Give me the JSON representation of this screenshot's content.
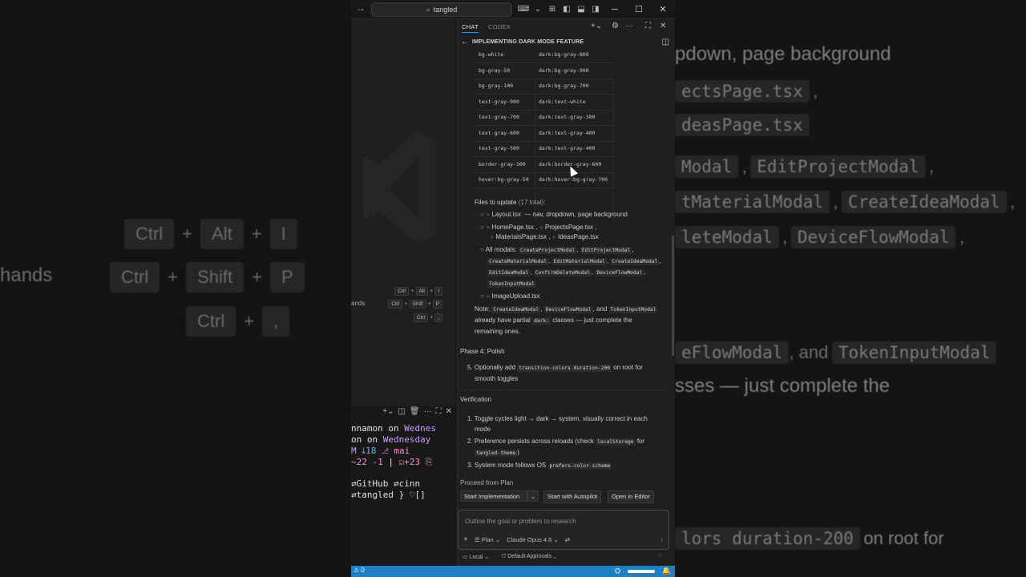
{
  "titlebar": {
    "search_text": "tangled"
  },
  "editor": {
    "shortcuts": [
      {
        "keys": [
          "Ctrl",
          "Alt",
          "I"
        ]
      },
      {
        "label": "ands",
        "keys": [
          "Ctrl",
          "Shift",
          "P"
        ]
      },
      {
        "keys": [
          "Ctrl",
          ","
        ]
      }
    ]
  },
  "terminal": {
    "lines": [
      {
        "parts": [
          {
            "t": "nnamon on ",
            "c": "#e0e0e0"
          },
          {
            "t": "Wednes",
            "c": "#c89cff"
          }
        ]
      },
      {
        "parts": [
          {
            "t": "on on ",
            "c": "#e0e0e0"
          },
          {
            "t": "Wednesday",
            "c": "#c89cff"
          }
        ]
      },
      {
        "parts": [
          {
            "t": "M  ",
            "c": "#c89cff"
          },
          {
            "t": "⤓18  ",
            "c": "#6ab0ff"
          },
          {
            "t": "⎇ mai",
            "c": "#ff8fd0"
          }
        ]
      },
      {
        "parts": [
          {
            "t": "~22 -1 ",
            "c": "#ff8fd0"
          },
          {
            "t": "| ",
            "c": "#e0e0e0"
          },
          {
            "t": "☑+23 ",
            "c": "#ff8fd0"
          },
          {
            "t": "⎘",
            "c": "#ff8fd0"
          }
        ]
      },
      {
        "parts": [
          {
            "t": "⇄GitHub ⇄cinn",
            "c": "#e0e0e0"
          }
        ]
      },
      {
        "parts": [
          {
            "t": "⇄tangled } ♡[]",
            "c": "#e0e0e0"
          }
        ]
      }
    ]
  },
  "chat": {
    "tabs": {
      "chat": "CHAT",
      "codex": "CODEX"
    },
    "title": "IMPLEMENTING DARK MODE FEATURE",
    "table": [
      [
        "bg-white",
        "dark:bg-gray-800"
      ],
      [
        "bg-gray-50",
        "dark:bg-gray-900"
      ],
      [
        "bg-gray-100",
        "dark:bg-gray-700"
      ],
      [
        "text-gray-900",
        "dark:text-white"
      ],
      [
        "text-gray-700",
        "dark:text-gray-300"
      ],
      [
        "text-gray-600",
        "dark:text-gray-400"
      ],
      [
        "text-gray-500",
        "dark:text-gray-400"
      ],
      [
        "border-gray-300",
        "dark:border-gray-600"
      ],
      [
        "hover:bg-gray-50",
        "dark:hover:bg-gray-700"
      ]
    ],
    "files_label": "Files to update",
    "files_count": "(17 total):",
    "layout_file": "Layout.tsx",
    "layout_desc": "— nav, dropdown, page background",
    "pages": [
      "HomePage.tsx",
      "ProjectsPage.tsx",
      "MaterialsPage.tsx",
      "IdeasPage.tsx"
    ],
    "modals_label": "All modals:",
    "modals": [
      "CreateProjectModal",
      "EditProjectModal",
      "CreateMaterialModal",
      "EditMaterialModal",
      "CreateIdeaModal",
      "EditIdeaModal",
      "ConfirmDeleteModal",
      "DeviceFlowModal",
      "TokenInputModal"
    ],
    "image_upload": "ImageUpload.tsx",
    "note_label": "Note:",
    "note_codes": [
      "CreateIdeaModal",
      "DeviceFlowModal",
      "TokenInputModal"
    ],
    "note_and": "and",
    "note_line2_pre": "already have partial",
    "note_code_dark": "dark:",
    "note_line2_post": "classes — just complete the",
    "note_line3": "remaining ones.",
    "phase4": "Phase 4: Polish",
    "step5_num": "5.",
    "step5_pre": "Optionally add",
    "step5_code": "transition-colors duration-200",
    "step5_post": "on root for",
    "step5_line2": "smooth toggles",
    "verification": "Verification",
    "v1_num": "1.",
    "v1_line1": "Toggle cycles light → dark → system, visually correct in each",
    "v1_line2": "mode",
    "v2_num": "2.",
    "v2_pre": "Preference persists across reloads (check",
    "v2_code": "localStorage",
    "v2_post": "for",
    "v2_code2": "tangled-theme",
    "v2_close": ")",
    "v3_num": "3.",
    "v3_pre": "System mode follows OS",
    "v3_code": "prefers-color-scheme",
    "proceed": "Proceed from Plan",
    "btn_start": "Start Implementation",
    "btn_autopilot": "Start with Autopilot",
    "btn_editor": "Open in Editor",
    "input_placeholder": "Outline the goal or problem to research",
    "mode": "Plan",
    "model": "Claude Opus 4.6",
    "local": "Local",
    "approvals": "Default Approvals"
  },
  "status": {
    "problems": "0"
  },
  "background_right": {
    "line1": "pdown, page background",
    "line2": "ectsPage.tsx",
    "line2_suffix": ",",
    "line3": "deasPage.tsx",
    "line4a": "Modal",
    "line4b": "EditProjectModal",
    "line4c": ",",
    "line5a": "tMaterialModal",
    "line5b": "CreateIdeaModal",
    "line5c": ",",
    "line6a": "leteModal",
    "line6b": "DeviceFlowModal",
    "line6c": ",",
    "line7a": "eFlowModal",
    "line7b": ", and",
    "line7c": "TokenInputModal",
    "line8": "sses — just complete the",
    "line9a": "lors duration-200",
    "line9b": "on root for"
  },
  "background_left": {
    "label": "hands",
    "r1": [
      "Ctrl",
      "Alt",
      "I"
    ],
    "r2": [
      "Ctrl",
      "Shift",
      "P"
    ],
    "r3": [
      "Ctrl",
      ","
    ]
  }
}
